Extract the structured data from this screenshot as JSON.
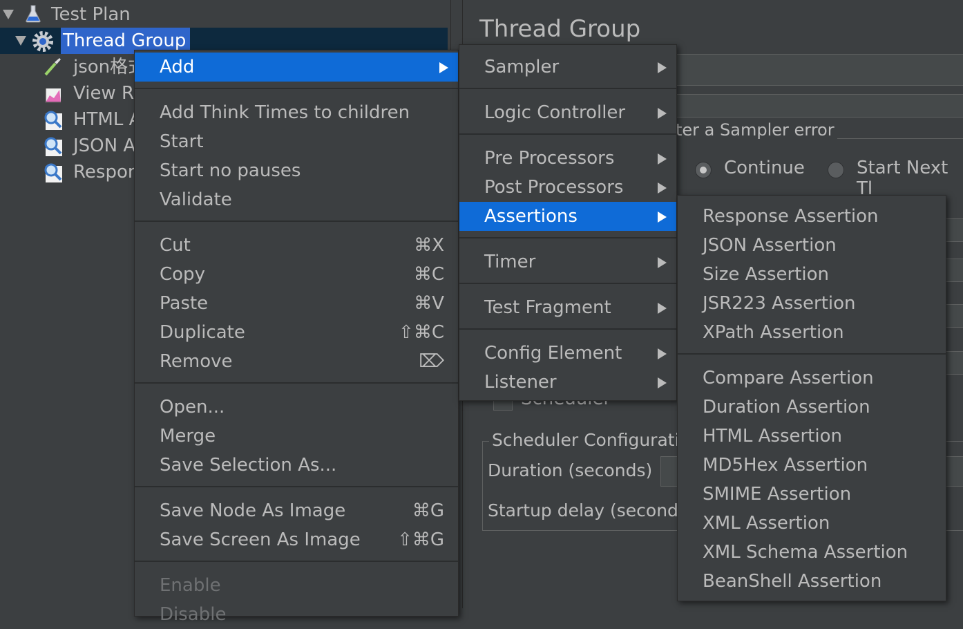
{
  "tree": {
    "items": [
      {
        "label": "Test Plan"
      },
      {
        "label": "Thread Group"
      },
      {
        "label": "json格式"
      },
      {
        "label": "View Re"
      },
      {
        "label": "HTML A"
      },
      {
        "label": "JSON As"
      },
      {
        "label": "Respon"
      }
    ]
  },
  "content": {
    "title": "Thread Group",
    "error_action_label": "ter a Sampler error",
    "radio_continue": "Continue",
    "radio_start_next": "Start Next Tl",
    "scheduler_checkbox": "Scheduler",
    "scheduler_config_legend": "Scheduler Configurati",
    "duration_label": "Duration (seconds)",
    "startup_delay_label": "Startup delay (seconds"
  },
  "context_menu": {
    "add": "Add",
    "add_think_times": "Add Think Times to children",
    "start": "Start",
    "start_no_pauses": "Start no pauses",
    "validate": "Validate",
    "cut": "Cut",
    "cut_sc": "⌘X",
    "copy": "Copy",
    "copy_sc": "⌘C",
    "paste": "Paste",
    "paste_sc": "⌘V",
    "duplicate": "Duplicate",
    "duplicate_sc": "⇧⌘C",
    "remove": "Remove",
    "remove_sc": "⌦",
    "open": "Open...",
    "merge": "Merge",
    "save_selection_as": "Save Selection As...",
    "save_node_image": "Save Node As Image",
    "save_node_image_sc": "⌘G",
    "save_screen_image": "Save Screen As Image",
    "save_screen_image_sc": "⇧⌘G",
    "enable": "Enable",
    "disable": "Disable"
  },
  "add_submenu": {
    "sampler": "Sampler",
    "logic_controller": "Logic Controller",
    "pre_processors": "Pre Processors",
    "post_processors": "Post Processors",
    "assertions": "Assertions",
    "timer": "Timer",
    "test_fragment": "Test Fragment",
    "config_element": "Config Element",
    "listener": "Listener"
  },
  "assertions_submenu": {
    "response": "Response Assertion",
    "json": "JSON Assertion",
    "size": "Size Assertion",
    "jsr223": "JSR223 Assertion",
    "xpath": "XPath Assertion",
    "compare": "Compare Assertion",
    "duration": "Duration Assertion",
    "html": "HTML Assertion",
    "md5hex": "MD5Hex Assertion",
    "smime": "SMIME Assertion",
    "xml": "XML Assertion",
    "xml_schema": "XML Schema Assertion",
    "beanshell": "BeanShell Assertion"
  },
  "colors": {
    "background": "#3c3f41",
    "selection": "#0f6bd7",
    "tree_selection": "#2f65ca",
    "text": "#bbbbbb"
  }
}
